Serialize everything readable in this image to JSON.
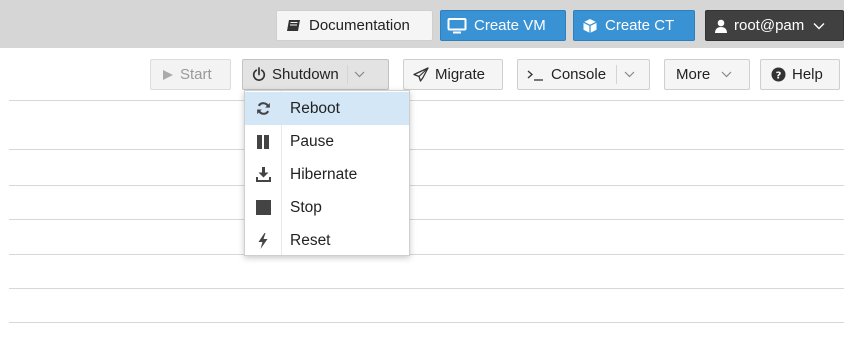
{
  "header": {
    "documentation": "Documentation",
    "create_vm": "Create VM",
    "create_ct": "Create CT",
    "user": "root@pam"
  },
  "toolbar": {
    "start": "Start",
    "shutdown": "Shutdown",
    "migrate": "Migrate",
    "console": "Console",
    "more": "More",
    "help": "Help"
  },
  "shutdown_menu": {
    "items": [
      {
        "label": "Reboot",
        "icon": "refresh-icon"
      },
      {
        "label": "Pause",
        "icon": "pause-icon"
      },
      {
        "label": "Hibernate",
        "icon": "download-icon"
      },
      {
        "label": "Stop",
        "icon": "stop-icon"
      },
      {
        "label": "Reset",
        "icon": "bolt-icon"
      }
    ],
    "active_index": 0
  },
  "colors": {
    "accent": "#3892d4",
    "topbar": "#d6d6d6",
    "user_button": "#404040",
    "menu_highlight": "#d4e7f7"
  }
}
